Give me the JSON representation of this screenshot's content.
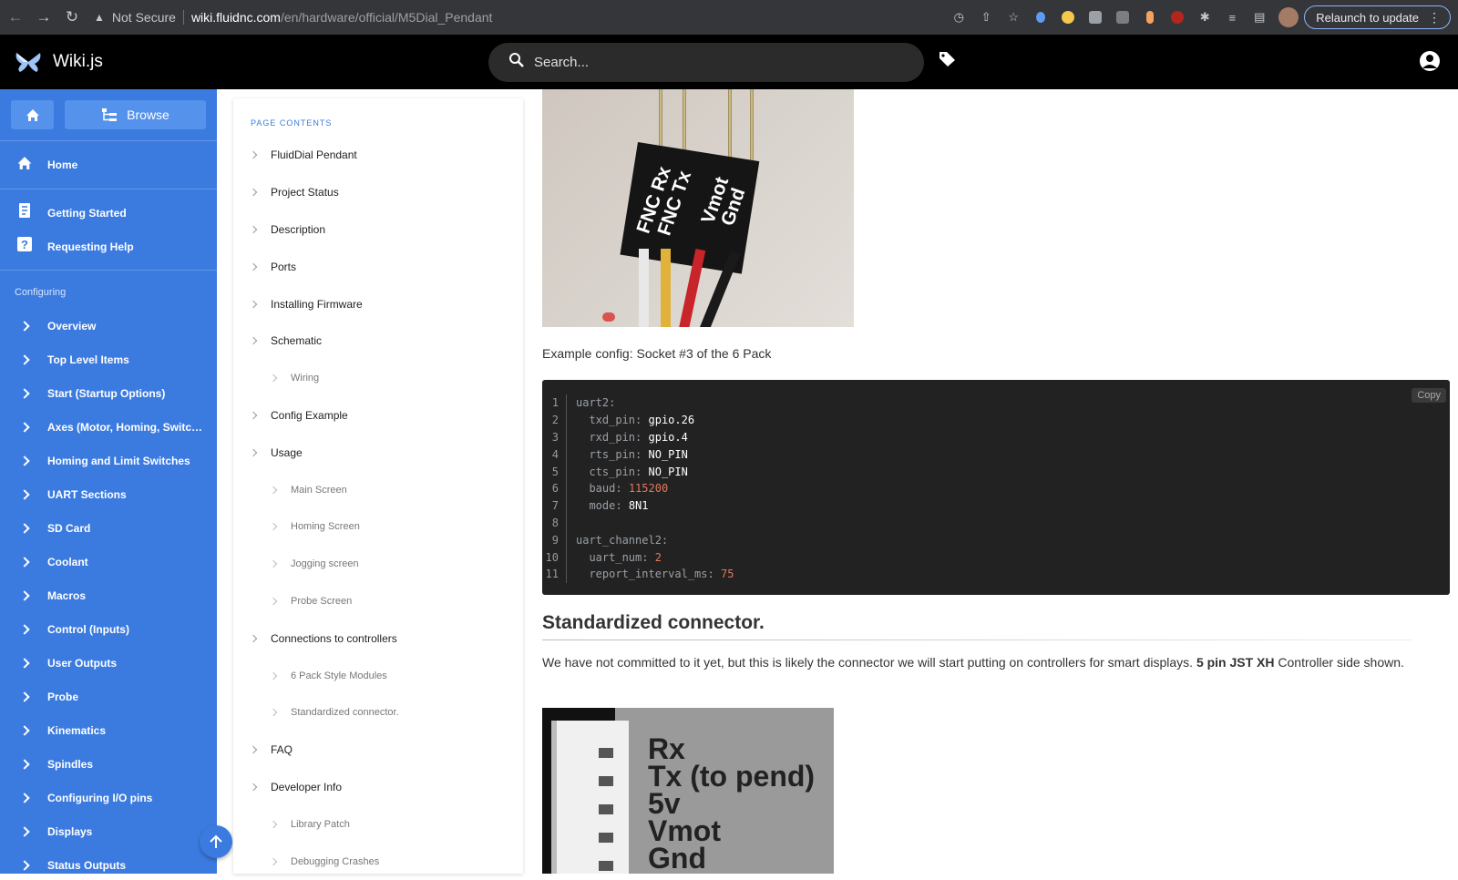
{
  "browser": {
    "not_secure": "Not Secure",
    "url_host": "wiki.fluidnc.com",
    "url_path": "/en/hardware/official/M5Dial_Pendant",
    "relaunch_label": "Relaunch to update"
  },
  "header": {
    "site_name": "Wiki.js",
    "search_placeholder": "Search..."
  },
  "sidebar": {
    "browse_label": "Browse",
    "top_items": [
      {
        "label": "Home",
        "icon": "home-icon"
      }
    ],
    "help_items": [
      {
        "label": "Getting Started",
        "icon": "document-icon"
      },
      {
        "label": "Requesting Help",
        "icon": "help-icon"
      }
    ],
    "section_label": "Configuring",
    "config_items": [
      "Overview",
      "Top Level Items",
      "Start (Startup Options)",
      "Axes (Motor, Homing, Switche...",
      "Homing and Limit Switches",
      "UART Sections",
      "SD Card",
      "Coolant",
      "Macros",
      "Control (Inputs)",
      "User Outputs",
      "Probe",
      "Kinematics",
      "Spindles",
      "Configuring I/O pins",
      "Displays",
      "Status Outputs"
    ]
  },
  "toc": {
    "title": "PAGE CONTENTS",
    "items": [
      {
        "label": "FluidDial Pendant",
        "level": 1
      },
      {
        "label": "Project Status",
        "level": 1
      },
      {
        "label": "Description",
        "level": 1
      },
      {
        "label": "Ports",
        "level": 1
      },
      {
        "label": "Installing Firmware",
        "level": 1
      },
      {
        "label": "Schematic",
        "level": 1
      },
      {
        "label": "Wiring",
        "level": 2
      },
      {
        "label": "Config Example",
        "level": 1
      },
      {
        "label": "Usage",
        "level": 1
      },
      {
        "label": "Main Screen",
        "level": 2
      },
      {
        "label": "Homing Screen",
        "level": 2
      },
      {
        "label": "Jogging screen",
        "level": 2
      },
      {
        "label": "Probe Screen",
        "level": 2
      },
      {
        "label": "Connections to controllers",
        "level": 1
      },
      {
        "label": "6 Pack Style Modules",
        "level": 2
      },
      {
        "label": "Standardized connector.",
        "level": 2
      },
      {
        "label": "FAQ",
        "level": 1
      },
      {
        "label": "Developer Info",
        "level": 1
      },
      {
        "label": "Library Patch",
        "level": 2
      },
      {
        "label": "Debugging Crashes",
        "level": 2
      }
    ]
  },
  "content": {
    "photo1_labels": [
      "FNC Rx",
      "FNC Tx",
      "Vmot",
      "Gnd"
    ],
    "photo_caption": "Example config: Socket #3 of the 6 Pack",
    "copy_label": "Copy",
    "code_lines": [
      {
        "n": "1",
        "indent": 0,
        "key": "uart2",
        "val": "",
        "type": ""
      },
      {
        "n": "2",
        "indent": 1,
        "key": "txd_pin",
        "val": "gpio.26",
        "type": "v"
      },
      {
        "n": "3",
        "indent": 1,
        "key": "rxd_pin",
        "val": "gpio.4",
        "type": "v"
      },
      {
        "n": "4",
        "indent": 1,
        "key": "rts_pin",
        "val": "NO_PIN",
        "type": "v"
      },
      {
        "n": "5",
        "indent": 1,
        "key": "cts_pin",
        "val": "NO_PIN",
        "type": "v"
      },
      {
        "n": "6",
        "indent": 1,
        "key": "baud",
        "val": "115200",
        "type": "n"
      },
      {
        "n": "7",
        "indent": 1,
        "key": "mode",
        "val": "8N1",
        "type": "v"
      },
      {
        "n": "8",
        "indent": 0,
        "key": "",
        "val": "",
        "type": ""
      },
      {
        "n": "9",
        "indent": 0,
        "key": "uart_channel2",
        "val": "",
        "type": ""
      },
      {
        "n": "10",
        "indent": 1,
        "key": "uart_num",
        "val": "2",
        "type": "n"
      },
      {
        "n": "11",
        "indent": 1,
        "key": "report_interval_ms",
        "val": "75",
        "type": "n"
      }
    ],
    "heading": "Standardized connector.",
    "para_before": "We have not committed to it yet, but this is likely the connector we will start putting on controllers for smart displays. ",
    "para_bold": "5 pin JST XH",
    "para_after": " Controller side shown.",
    "photo2_labels": [
      "Rx",
      "Tx (to pend)",
      "5v",
      "Vmot",
      "Gnd"
    ]
  }
}
